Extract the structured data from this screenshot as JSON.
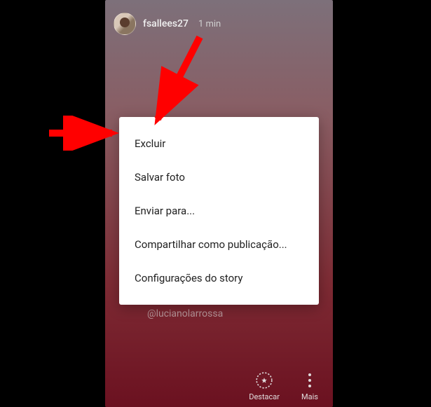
{
  "story": {
    "username": "fsallees27",
    "timestamp": "1 min",
    "mention": "@lucianolarrossa"
  },
  "menu": {
    "items": [
      "Excluir",
      "Salvar foto",
      "Enviar para...",
      "Compartilhar como publicação...",
      "Configurações do story"
    ]
  },
  "bottom": {
    "highlight": "Destacar",
    "more": "Mais"
  }
}
